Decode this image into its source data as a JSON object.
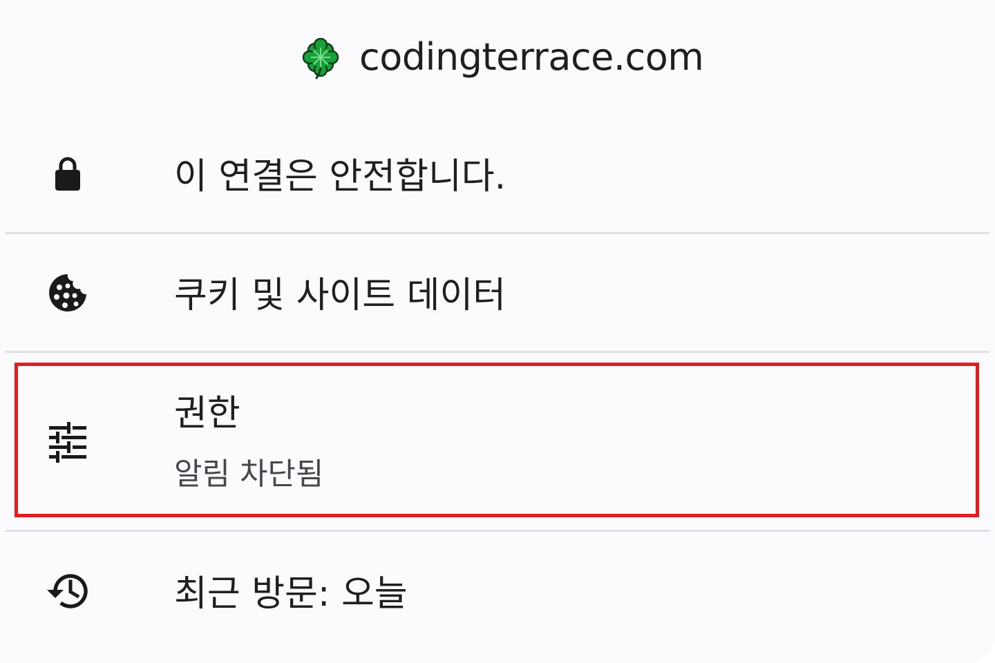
{
  "header": {
    "site_icon": "four-leaf-clover-icon",
    "site_name": "codingterrace.com"
  },
  "rows": [
    {
      "icon": "lock-icon",
      "label": "이 연결은 안전합니다."
    },
    {
      "icon": "cookie-icon",
      "label": "쿠키 및 사이트 데이터"
    },
    {
      "icon": "tune-sliders-icon",
      "label": "권한",
      "sublabel": "알림 차단됨",
      "highlighted": true,
      "highlight_color": "#e31b23"
    },
    {
      "icon": "history-icon",
      "label": "최근 방문: 오늘"
    }
  ],
  "colors": {
    "background": "#fbfbfe",
    "divider": "#dedee3",
    "highlight": "#e31b23",
    "clover_green": "#1aa03a"
  }
}
